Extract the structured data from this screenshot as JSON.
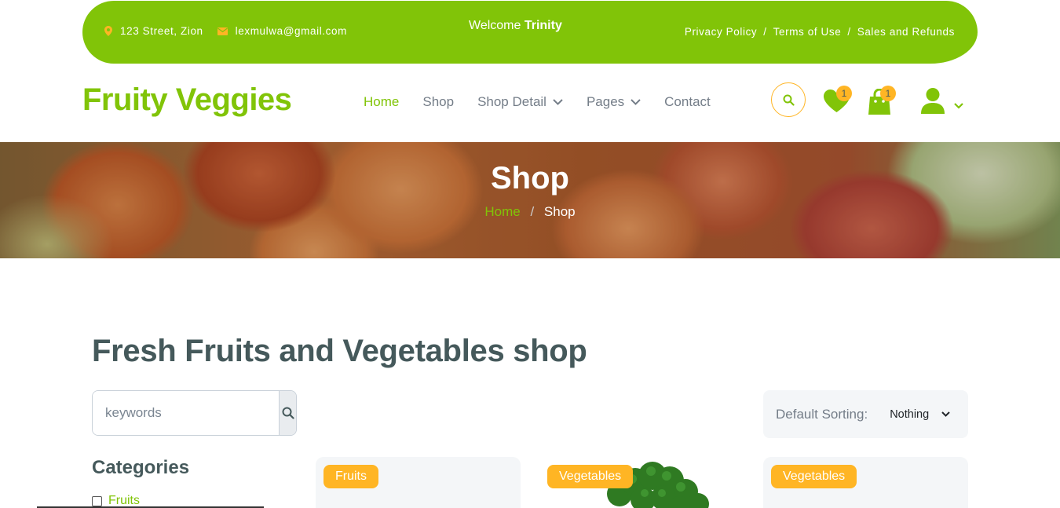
{
  "topbar": {
    "address": "123 Street, Zion",
    "email": "lexmulwa@gmail.com",
    "welcome_prefix": "Welcome",
    "welcome_name": "Trinity",
    "links": [
      "Privacy Policy",
      "Terms of Use",
      "Sales and Refunds"
    ],
    "separator": "/"
  },
  "brand": "Fruity Veggies",
  "nav": {
    "items": [
      {
        "label": "Home",
        "active": true
      },
      {
        "label": "Shop"
      },
      {
        "label": "Shop Detail",
        "dropdown": true
      },
      {
        "label": "Pages",
        "dropdown": true
      },
      {
        "label": "Contact"
      }
    ],
    "wishlist_count": "1",
    "cart_count": "1"
  },
  "hero": {
    "title": "Shop",
    "breadcrumb": [
      "Home",
      "Shop"
    ],
    "separator": "/"
  },
  "main": {
    "heading": "Fresh Fruits and Vegetables shop",
    "search_placeholder": "keywords",
    "sorting_label": "Default Sorting:",
    "sorting_value": "Nothing",
    "categories_heading": "Categories",
    "categories": [
      "Fruits"
    ],
    "cards": [
      {
        "tag": "Fruits"
      },
      {
        "tag": "Vegetables"
      },
      {
        "tag": "Vegetables"
      }
    ]
  },
  "colors": {
    "primary": "#81c408",
    "secondary": "#ffb524",
    "text": "#45595b"
  },
  "icons": {
    "address": "map-marker-icon",
    "email": "envelope-icon",
    "search": "search-icon",
    "wishlist": "heart-icon",
    "cart": "shopping-bag-icon",
    "user": "user-icon"
  }
}
